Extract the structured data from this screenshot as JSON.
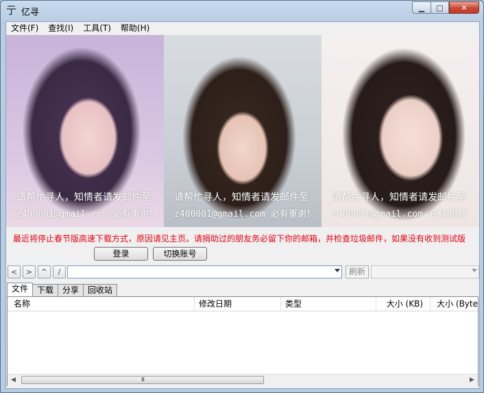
{
  "window": {
    "title": "亿寻",
    "app_icon": "亍",
    "controls": {
      "minimize": "▁",
      "maximize": "□",
      "close": "✕"
    }
  },
  "menu": [
    {
      "label": "文件(F)"
    },
    {
      "label": "查找(I)"
    },
    {
      "label": "工具(T)"
    },
    {
      "label": "帮助(H)"
    }
  ],
  "banner": {
    "panels": [
      {
        "caption1": "请帮忙寻人，知情者请发邮件至",
        "caption2": "z400001@gmail.com 必有重谢！"
      },
      {
        "caption1": "请帮忙寻人，知情者请发邮件至",
        "caption2": "z400001@gmail.com 必有重谢！"
      },
      {
        "caption1": "请帮忙寻人，知情者请发邮件至",
        "caption2": "z400001@gmail.com 必有重谢！"
      }
    ]
  },
  "notice": "最近将停止春节版高速下载方式，原因请见主页。请捐助过的朋友务必留下你的邮箱，并检查垃圾邮件，如果没有收到测试版",
  "buttons": {
    "login": "登录",
    "switch_account": "切换账号"
  },
  "nav": {
    "back": "<",
    "forward": ">",
    "up": "^",
    "root": "/",
    "path_value": "",
    "refresh": "刷新",
    "secondary_value": ""
  },
  "tabs": [
    {
      "label": "文件",
      "active": true
    },
    {
      "label": "下载",
      "active": false
    },
    {
      "label": "分享",
      "active": false
    },
    {
      "label": "回收站",
      "active": false
    }
  ],
  "list": {
    "columns": [
      "名称",
      "修改日期",
      "类型",
      "大小 (KB)",
      "大小 (Byte"
    ],
    "rows": []
  },
  "scrollbar": {
    "left_arrow": "◀",
    "right_arrow": "▶",
    "grip": "III"
  },
  "colors": {
    "notice": "#e60012",
    "close_button": "#c94a36"
  }
}
